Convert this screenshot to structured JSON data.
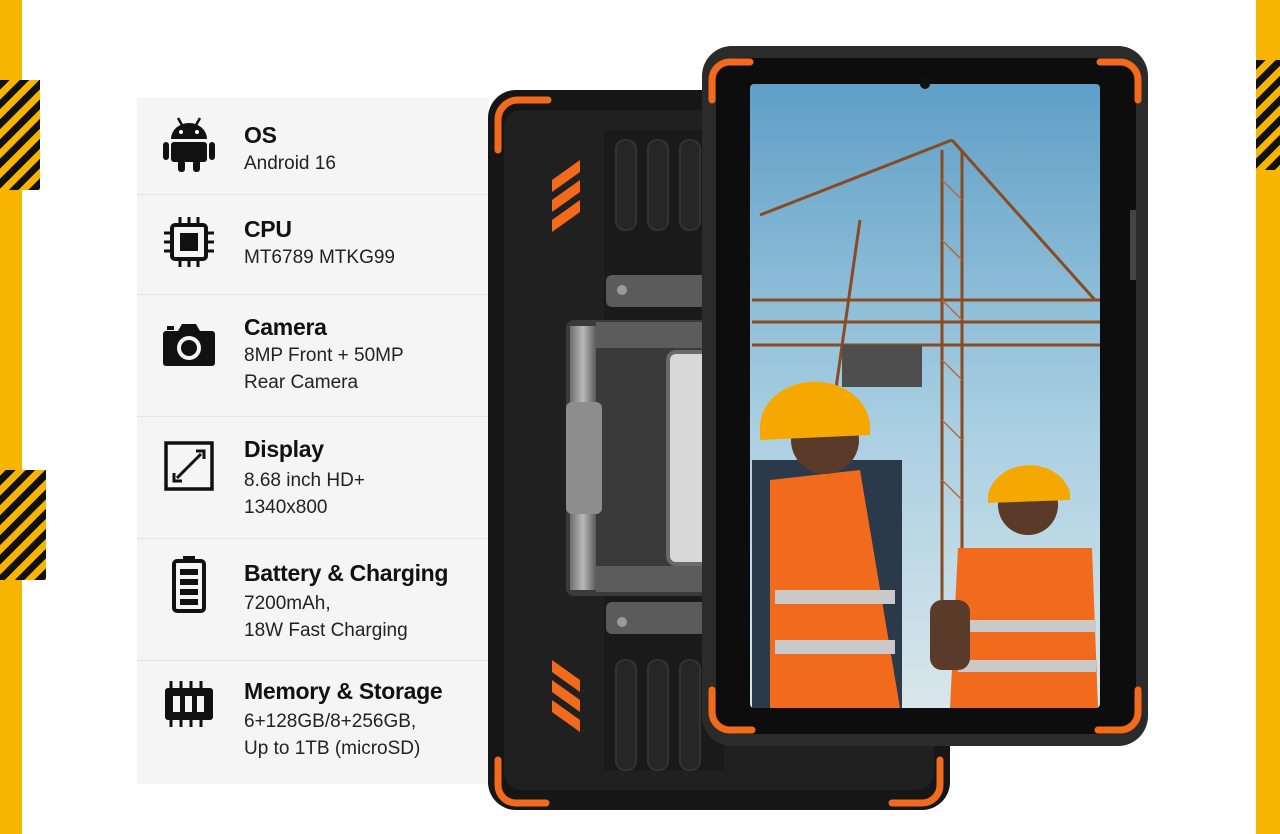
{
  "specs": [
    {
      "title": "OS",
      "value": "Android 16",
      "icon": "android-icon"
    },
    {
      "title": "CPU",
      "value": "MT6789 MTKG99",
      "icon": "chip-icon"
    },
    {
      "title": "Camera",
      "value": "8MP Front + 50MP\nRear Camera",
      "icon": "camera-icon"
    },
    {
      "title": "Display",
      "value": "8.68 inch HD+\n1340x800",
      "icon": "display-icon"
    },
    {
      "title": "Battery & Charging",
      "value": "7200mAh,\n18W Fast Charging",
      "icon": "battery-icon"
    },
    {
      "title": "Memory & Storage",
      "value": "6+128GB/8+256GB,\nUp to 1TB (microSD)",
      "icon": "memory-icon"
    }
  ],
  "colors": {
    "accent_orange": "#f26a1b",
    "frame_yellow": "#f7b500",
    "device_body": "#1c1c1c",
    "panel_bg": "#f5f5f5",
    "sky": "#6fa9cc"
  }
}
